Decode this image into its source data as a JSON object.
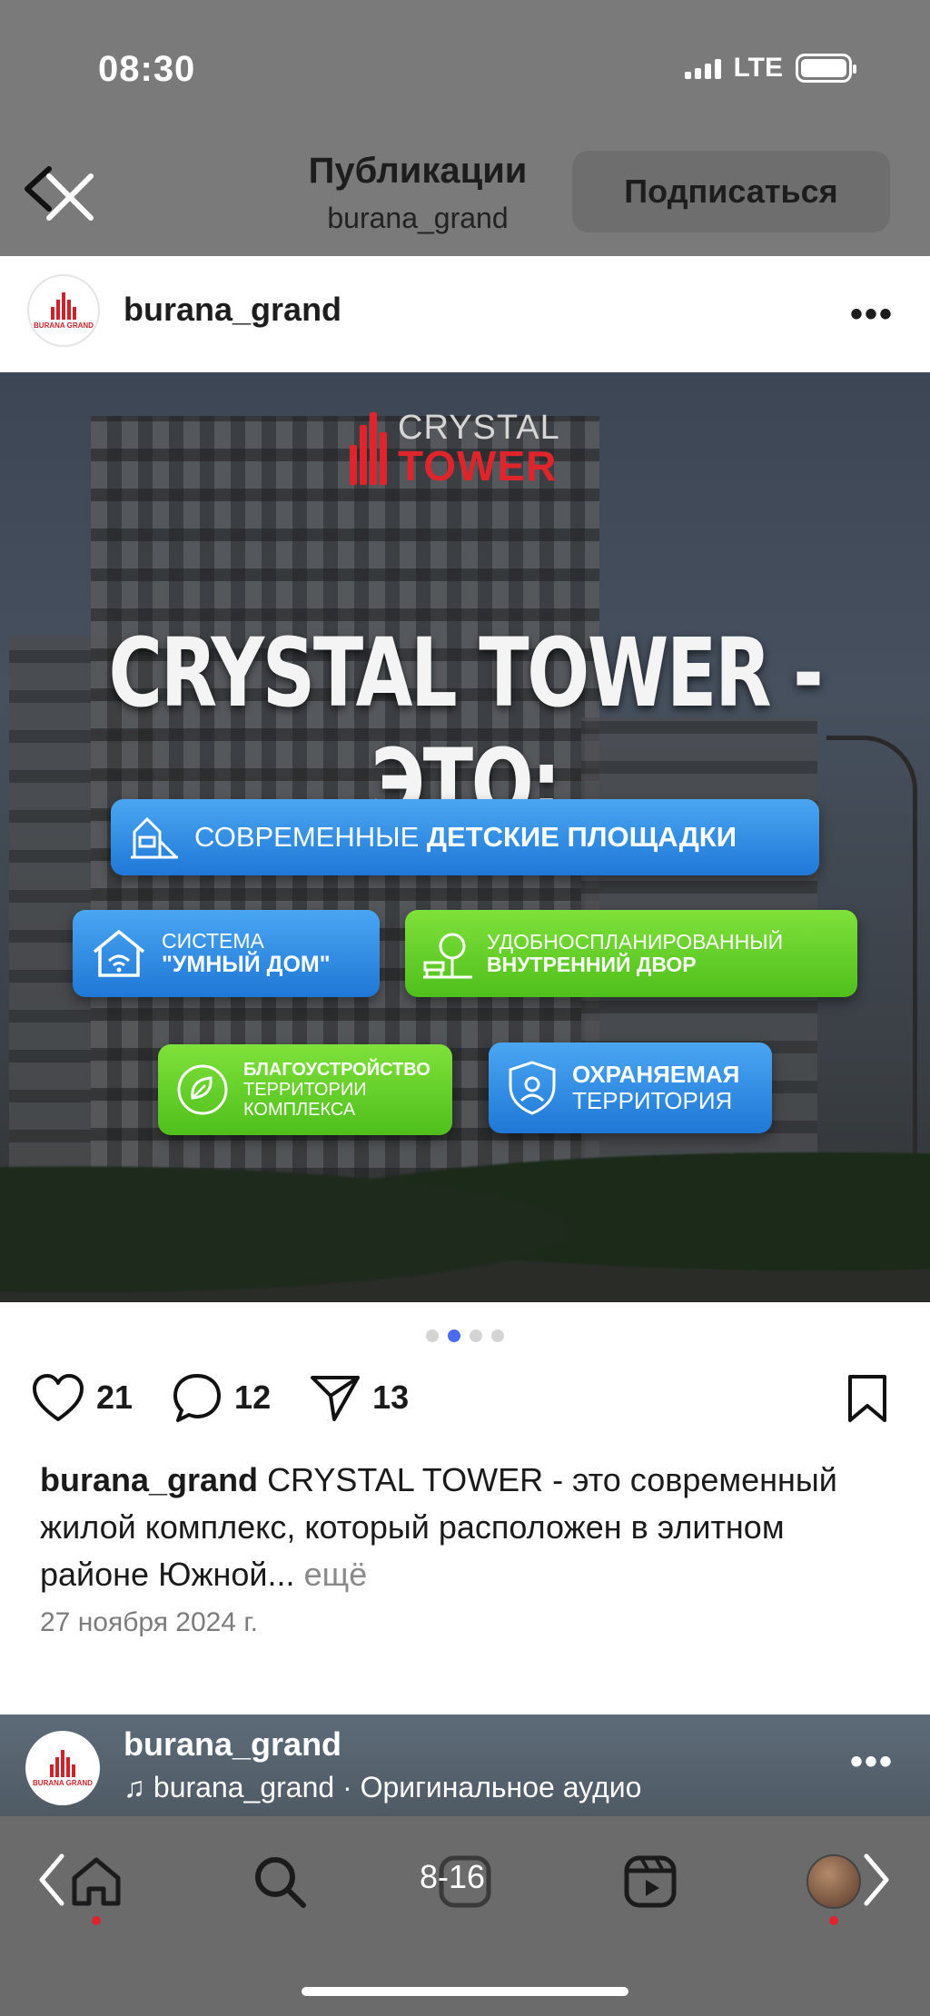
{
  "status_bar": {
    "time": "08:30",
    "network": "LTE"
  },
  "header": {
    "title": "Публикации",
    "subtitle": "burana_grand",
    "subscribe_label": "Подписаться"
  },
  "post": {
    "username": "burana_grand",
    "avatar_text": "BURANA GRAND",
    "image": {
      "logo_top": "CRYSTAL",
      "logo_bottom": "TOWER",
      "headline": "CRYSTAL TOWER - ЭТО:",
      "features": [
        {
          "light": "СОВРЕМЕННЫЕ",
          "bold": "ДЕТСКИЕ ПЛОЩАДКИ",
          "icon": "playground-icon",
          "color": "blue"
        },
        {
          "light": "СИСТЕМА",
          "bold": "\"УМНЫЙ ДОМ\"",
          "icon": "smart-home-icon",
          "color": "blue"
        },
        {
          "light": "УДОБНОСПЛАНИРОВАННЫЙ",
          "bold": "ВНУТРЕННИЙ ДВОР",
          "icon": "courtyard-icon",
          "color": "green"
        },
        {
          "bold": "БЛАГОУСТРОЙСТВО",
          "light": "ТЕРРИТОРИИ КОМПЛЕКСА",
          "icon": "eco-icon",
          "color": "green"
        },
        {
          "bold": "ОХРАНЯЕМАЯ",
          "light": "ТЕРРИТОРИЯ",
          "icon": "security-shield-icon",
          "color": "blue"
        }
      ]
    },
    "carousel": {
      "total": 4,
      "active": 2
    },
    "likes": "21",
    "comments": "12",
    "shares": "13",
    "caption_user": "burana_grand",
    "caption_text": "CRYSTAL TOWER - это современный жилой комплекс, который расположен в элитном районе Южной...",
    "caption_more": "ещё",
    "date": "27 ноября 2024 г."
  },
  "next_post": {
    "username": "burana_grand",
    "audio": "burana_grand · Оригинальное аудио"
  },
  "bottom_bar": {
    "page_indicator": "8-16"
  },
  "colors": {
    "brand_red": "#e0242b",
    "feature_blue": "#2f8be6",
    "feature_green": "#5fcc26",
    "active_dot": "#4a6cf0"
  }
}
